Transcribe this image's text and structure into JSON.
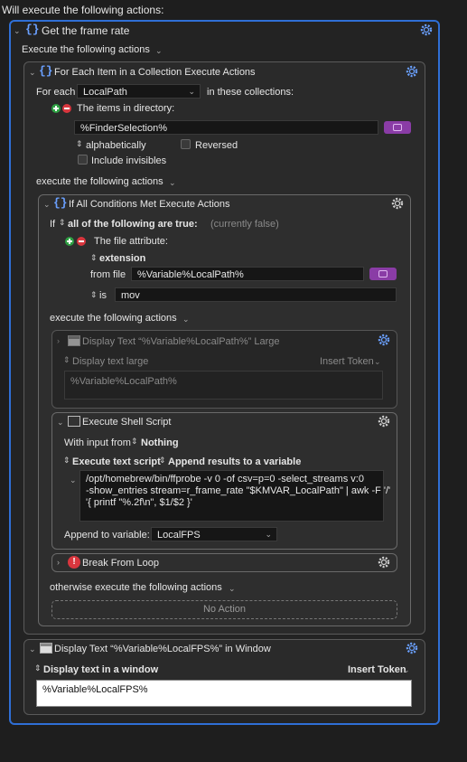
{
  "header": "Will execute the following actions:",
  "group": {
    "title": "Get the frame rate",
    "execute_label": "Execute the following actions"
  },
  "foreach": {
    "title": "For Each Item in a Collection Execute Actions",
    "for_each_label": "For each",
    "variable": "LocalPath",
    "in_collections": "in these collections:",
    "collection_label": "The items in directory:",
    "path": "%FinderSelection%",
    "sort": "alphabetically",
    "reversed": "Reversed",
    "invisibles": "Include invisibles",
    "execute_label": "execute the following actions"
  },
  "ifblock": {
    "title": "If All Conditions Met Execute Actions",
    "if_label": "If",
    "condition_mode": "all of the following are true:",
    "status": "(currently false)",
    "attr_label": "The file attribute:",
    "attr_kind": "extension",
    "from_file_label": "from file",
    "from_file": "%Variable%LocalPath%",
    "is_label": "is",
    "is_value": "mov",
    "execute_label": "execute the following actions",
    "otherwise_label": "otherwise execute the following actions",
    "no_action": "No Action"
  },
  "display_large": {
    "title": "Display Text “%Variable%LocalPath%” Large",
    "mode": "Display text large",
    "insert_token": "Insert Token",
    "text": "%Variable%LocalPath%"
  },
  "shell": {
    "title": "Execute Shell Script",
    "input_label": "With input from",
    "input_value": "Nothing",
    "exec_mode": "Execute text script",
    "result_mode": "Append results to a variable",
    "script_line1": "/opt/homebrew/bin/ffprobe -v 0 -of csv=p=0 -select_streams v:0",
    "script_line2": "-show_entries stream=r_frame_rate \"$KMVAR_LocalPath\" | awk -F '/'",
    "script_line3": "'{ printf \"%.2f\\n\", $1/$2 }'",
    "append_label": "Append to variable:",
    "append_var": "LocalFPS"
  },
  "break_loop": {
    "title": "Break From Loop"
  },
  "display_window": {
    "title": "Display Text “%Variable%LocalFPS%” in Window",
    "mode": "Display text in a window",
    "insert_token": "Insert Token",
    "text": "%Variable%LocalFPS%"
  },
  "colors": {
    "accent": "#2f6fd6",
    "braces": "#6aa0ff",
    "green": "#2ea043",
    "red": "#d9363e",
    "purple": "#8a3ca6"
  }
}
